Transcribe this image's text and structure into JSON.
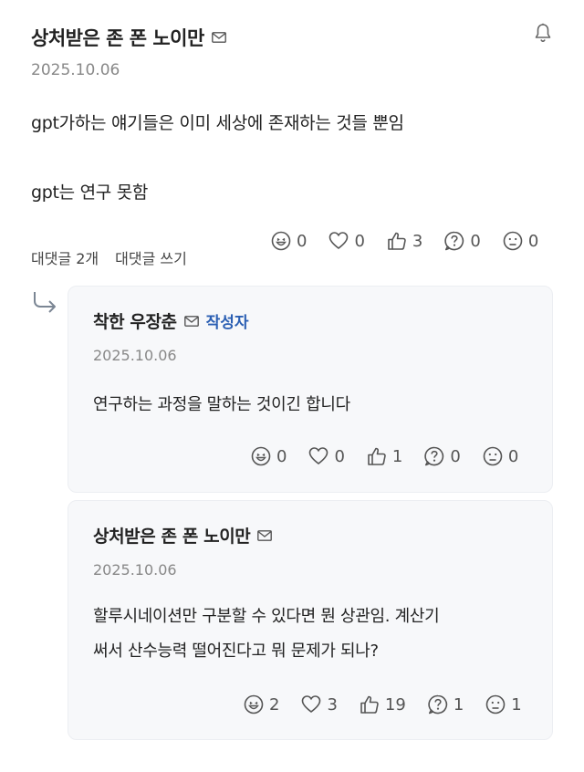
{
  "post": {
    "author": "상처받은 존 폰 노이만",
    "date": "2025.10.06",
    "lines": [
      "gpt가하는 얘기들은 이미 세상에 존재하는 것들 뿐임",
      "gpt는 연구 못함"
    ],
    "reactions": {
      "laugh": "0",
      "heart": "0",
      "like": "3",
      "question": "0",
      "sad": "0"
    },
    "reply_count_label": "대댓글 2개",
    "write_reply_label": "대댓글 쓰기"
  },
  "replies": [
    {
      "author": "착한 우장춘",
      "badge": "작성자",
      "date": "2025.10.06",
      "lines": [
        "연구하는 과정을 말하는 것이긴 합니다"
      ],
      "reactions": {
        "laugh": "0",
        "heart": "0",
        "like": "1",
        "question": "0",
        "sad": "0"
      }
    },
    {
      "author": "상처받은 존 폰 노이만",
      "date": "2025.10.06",
      "lines": [
        "할루시네이션만 구분할 수 있다면 뭔 상관임. 계산기",
        "써서 산수능력 떨어진다고 뭐 문제가 되나?"
      ],
      "reactions": {
        "laugh": "2",
        "heart": "3",
        "like": "19",
        "question": "1",
        "sad": "1"
      }
    }
  ],
  "icons": [
    "mail-icon",
    "bell-icon",
    "laugh-icon",
    "heart-icon",
    "thumbs-up-icon",
    "question-icon",
    "sad-icon",
    "reply-arrow-icon"
  ]
}
